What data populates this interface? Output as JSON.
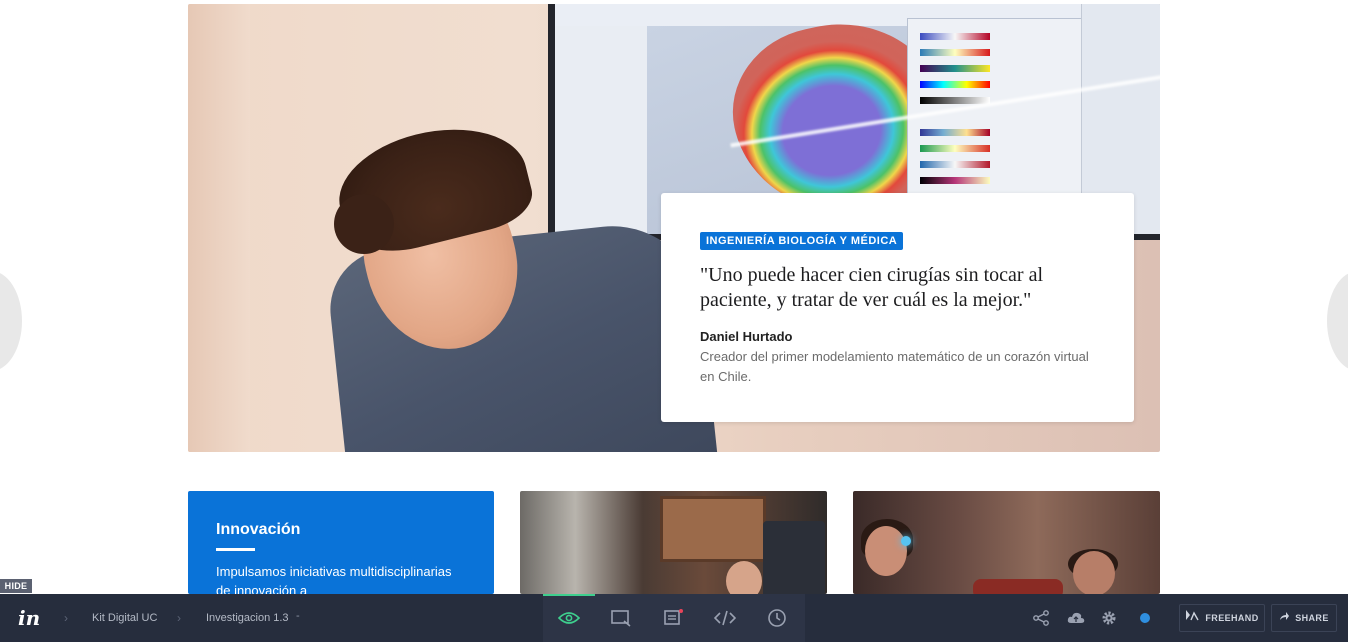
{
  "hero": {
    "tag": "INGENIERÍA BIOLOGÍA Y MÉDICA",
    "quote": "\"Uno puede hacer cien cirugías sin tocar al paciente, y tratar de ver cuál es la mejor.\"",
    "author": "Daniel Hurtado",
    "author_description": "Creador del primer modelamiento matemático de un corazón virtual en Chile."
  },
  "cards": [
    {
      "title": "Innovación",
      "text": "Impulsamos iniciativas multidisciplinarias de innovación a"
    }
  ],
  "hide_badge": "HIDE",
  "toolbar": {
    "logo": "in",
    "breadcrumb": [
      "Kit Digital UC",
      "Investigacion 1.3"
    ],
    "dropdown_indicator": "-",
    "center_icons": [
      "preview-eye-icon",
      "screen-icon",
      "comment-icon",
      "code-icon",
      "history-clock-icon"
    ],
    "right_icons": [
      "share-nodes-icon",
      "cloud-icon",
      "gear-icon",
      "status-dot"
    ],
    "freehand_label": "FREEHAND",
    "share_label": "SHARE"
  },
  "colors": {
    "accent_blue": "#0a73d8",
    "toolbar_bg": "#262d3d",
    "active_green": "#3ecf8e",
    "comment_notification": "#e8445a"
  }
}
